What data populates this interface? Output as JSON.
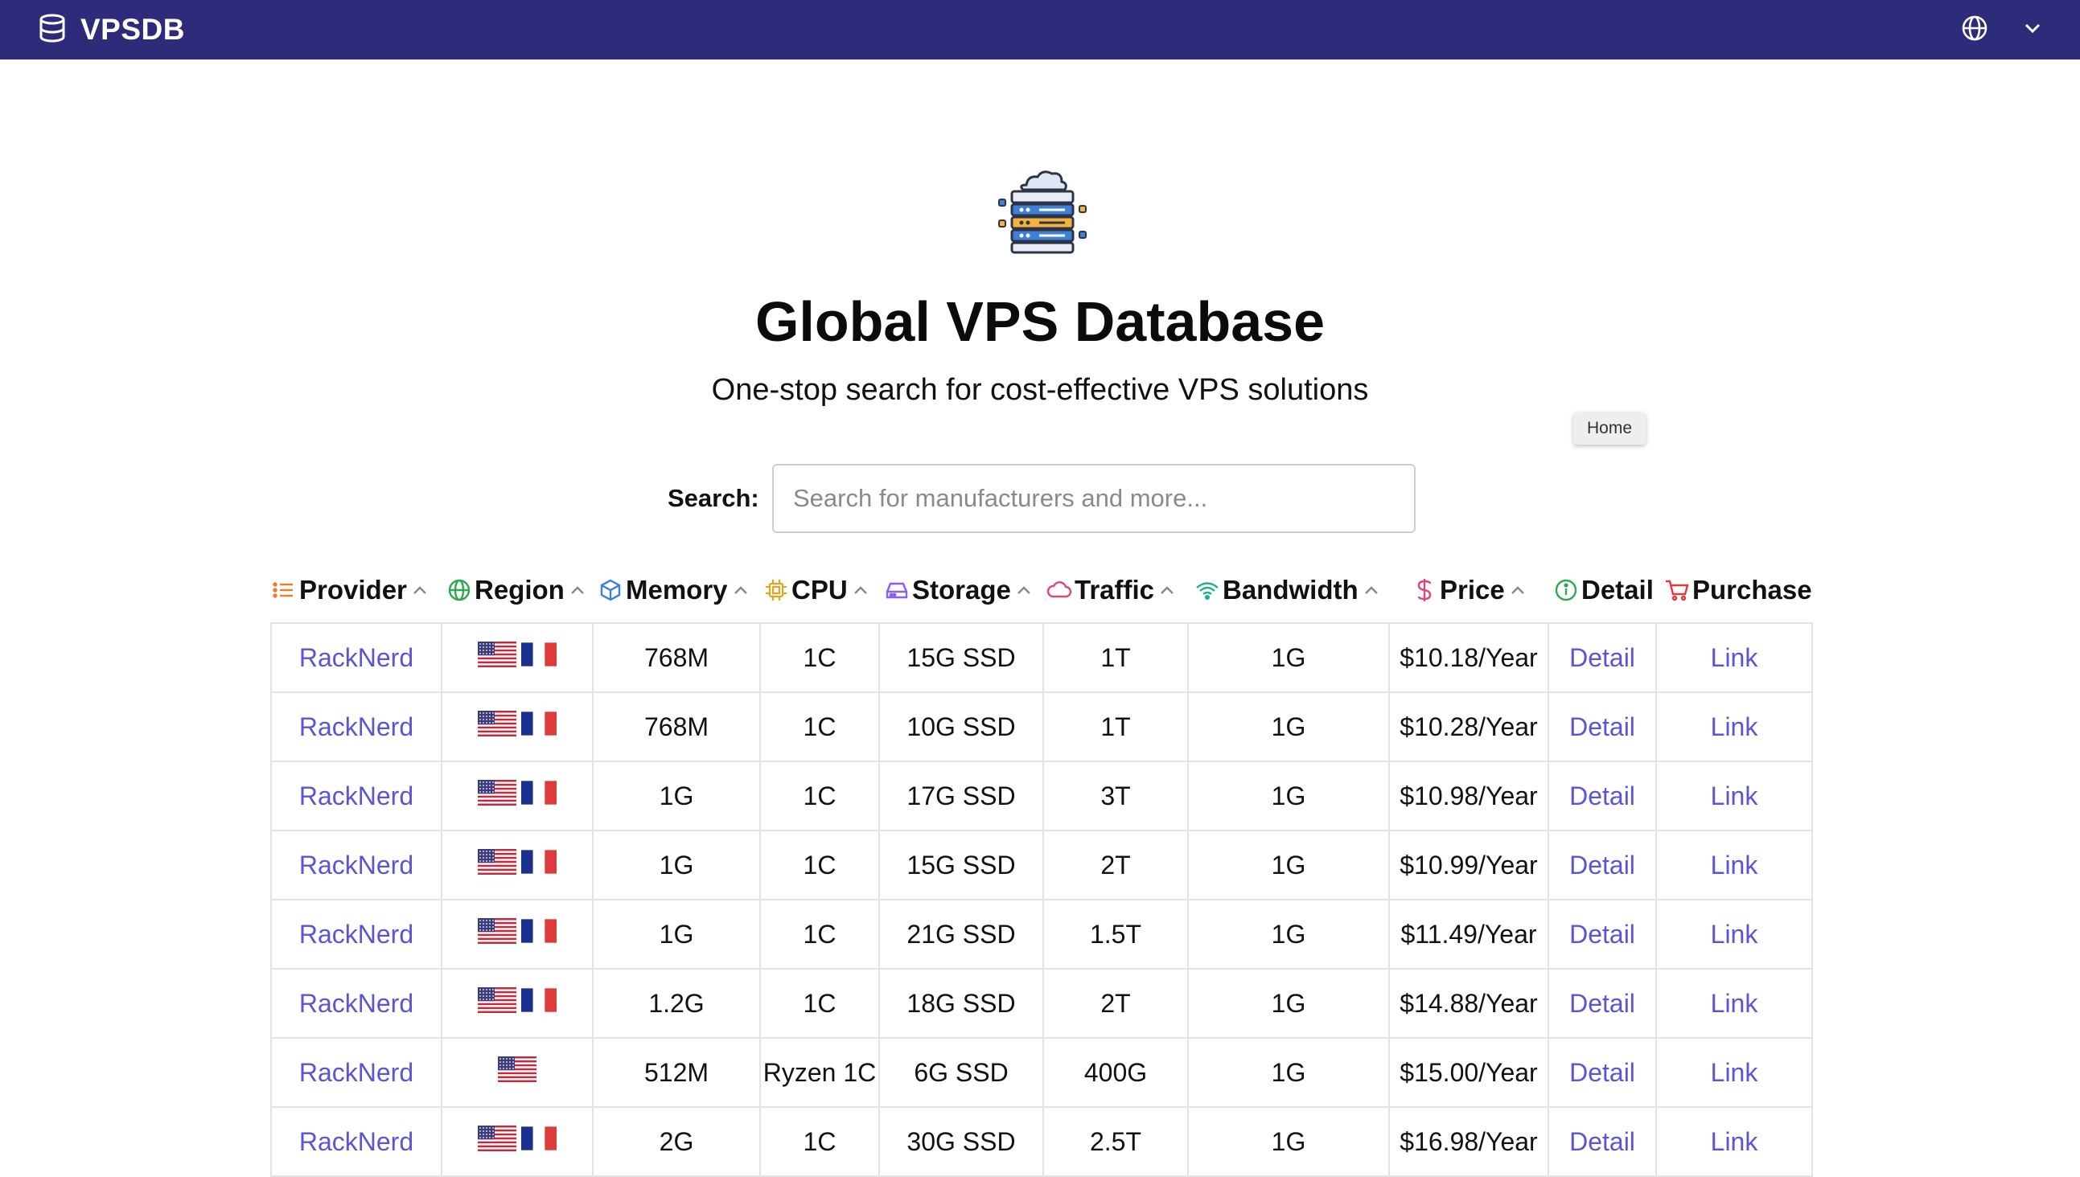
{
  "app": {
    "name": "VPSDB"
  },
  "hero": {
    "title": "Global VPS Database",
    "subtitle": "One-stop search for cost-effective VPS solutions",
    "tooltip": "Home"
  },
  "search": {
    "label": "Search:",
    "placeholder": "Search for manufacturers and more...",
    "value": ""
  },
  "table": {
    "columns": [
      "Provider",
      "Region",
      "Memory",
      "CPU",
      "Storage",
      "Traffic",
      "Bandwidth",
      "Price",
      "Detail",
      "Purchase"
    ],
    "rows": [
      {
        "provider": "RackNerd",
        "region": "us-fr",
        "memory": "768M",
        "cpu": "1C",
        "storage": "15G SSD",
        "traffic": "1T",
        "bandwidth": "1G",
        "price": "$10.18/Year",
        "detail": "Detail",
        "purchase": "Link"
      },
      {
        "provider": "RackNerd",
        "region": "us-fr",
        "memory": "768M",
        "cpu": "1C",
        "storage": "10G SSD",
        "traffic": "1T",
        "bandwidth": "1G",
        "price": "$10.28/Year",
        "detail": "Detail",
        "purchase": "Link"
      },
      {
        "provider": "RackNerd",
        "region": "us-fr",
        "memory": "1G",
        "cpu": "1C",
        "storage": "17G SSD",
        "traffic": "3T",
        "bandwidth": "1G",
        "price": "$10.98/Year",
        "detail": "Detail",
        "purchase": "Link"
      },
      {
        "provider": "RackNerd",
        "region": "us-fr",
        "memory": "1G",
        "cpu": "1C",
        "storage": "15G SSD",
        "traffic": "2T",
        "bandwidth": "1G",
        "price": "$10.99/Year",
        "detail": "Detail",
        "purchase": "Link"
      },
      {
        "provider": "RackNerd",
        "region": "us-fr",
        "memory": "1G",
        "cpu": "1C",
        "storage": "21G SSD",
        "traffic": "1.5T",
        "bandwidth": "1G",
        "price": "$11.49/Year",
        "detail": "Detail",
        "purchase": "Link"
      },
      {
        "provider": "RackNerd",
        "region": "us-fr",
        "memory": "1.2G",
        "cpu": "1C",
        "storage": "18G SSD",
        "traffic": "2T",
        "bandwidth": "1G",
        "price": "$14.88/Year",
        "detail": "Detail",
        "purchase": "Link"
      },
      {
        "provider": "RackNerd",
        "region": "us",
        "memory": "512M",
        "cpu": "Ryzen 1C",
        "storage": "6G SSD",
        "traffic": "400G",
        "bandwidth": "1G",
        "price": "$15.00/Year",
        "detail": "Detail",
        "purchase": "Link"
      },
      {
        "provider": "RackNerd",
        "region": "us-fr",
        "memory": "2G",
        "cpu": "1C",
        "storage": "30G SSD",
        "traffic": "2.5T",
        "bandwidth": "1G",
        "price": "$16.98/Year",
        "detail": "Detail",
        "purchase": "Link"
      }
    ]
  },
  "icons": {
    "brand": "database-icon",
    "language": "globe-icon",
    "menu": "chevron-down-icon",
    "provider": "list-icon",
    "region": "globe-icon",
    "memory": "cube-icon",
    "cpu": "chip-icon",
    "storage": "hard-drive-icon",
    "traffic": "cloud-icon",
    "bandwidth": "wifi-icon",
    "price": "dollar-icon",
    "detail": "info-icon",
    "purchase": "cart-icon",
    "sort": "caret-up-icon"
  },
  "colors": {
    "topbar": "#2e2b7a",
    "link": "#5a55d6",
    "provider_icon": "#f07c2b",
    "region_icon": "#2fa84f",
    "memory_icon": "#3b7fe0",
    "cpu_icon": "#e6a51e",
    "storage_icon": "#8b5cf6",
    "traffic_icon": "#e0457b",
    "bandwidth_icon": "#1fae8f",
    "price_icon": "#e0457b",
    "detail_icon": "#2fa84f",
    "purchase_icon": "#e03b3b"
  }
}
